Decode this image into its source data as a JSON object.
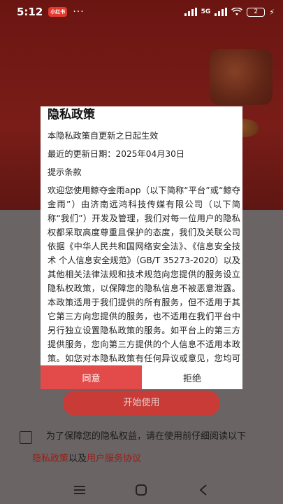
{
  "status_bar": {
    "time": "5:12",
    "app_badge": "小红书",
    "more": "···",
    "network": "5G",
    "battery": "2"
  },
  "dialog": {
    "title": "隐私政策",
    "effective": "本隐私政策自更新之日起生效",
    "updated": "最近的更新日期：2025年04月30日",
    "notice": "提示条款",
    "body": "欢迎您使用鲸夺金雨app（以下简称“平台”或“鲸夺金雨”）由济南远鸿科技传媒有限公司（以下简称“我们”）开发及管理，我们对每一位用户的隐私权都采取高度尊重且保护的态度，我们及关联公司依据《中华人民共和国网络安全法》、《信息安全技术 个人信息安全规范》（GB/T 35273-2020）以及其他相关法律法规和技术规范向您提供的服务设立隐私权政策，以保障您的隐私信息不被恶意泄露。本政策适用于我们提供的所有服务，但不适用于其它第三方向您提供的服务，也不适用在我们平台中另行独立设置隐私政策的服务。如平台上的第三方提供服务，您向第三方提供的个人信息不适用本政策。如您对本隐私政策有任何异议或意见，您均可与我们联系。",
    "agree": "同意",
    "refuse": "拒绝"
  },
  "page": {
    "start_button": "开始使用",
    "consent_text": "为了保障您的隐私权益，请在使用前仔细阅读以下",
    "privacy_link": "隐私政策",
    "joiner": "以及",
    "service_link": "用户服务协议"
  },
  "colors": {
    "accent": "#e34b4b",
    "link": "#9a1e18"
  }
}
